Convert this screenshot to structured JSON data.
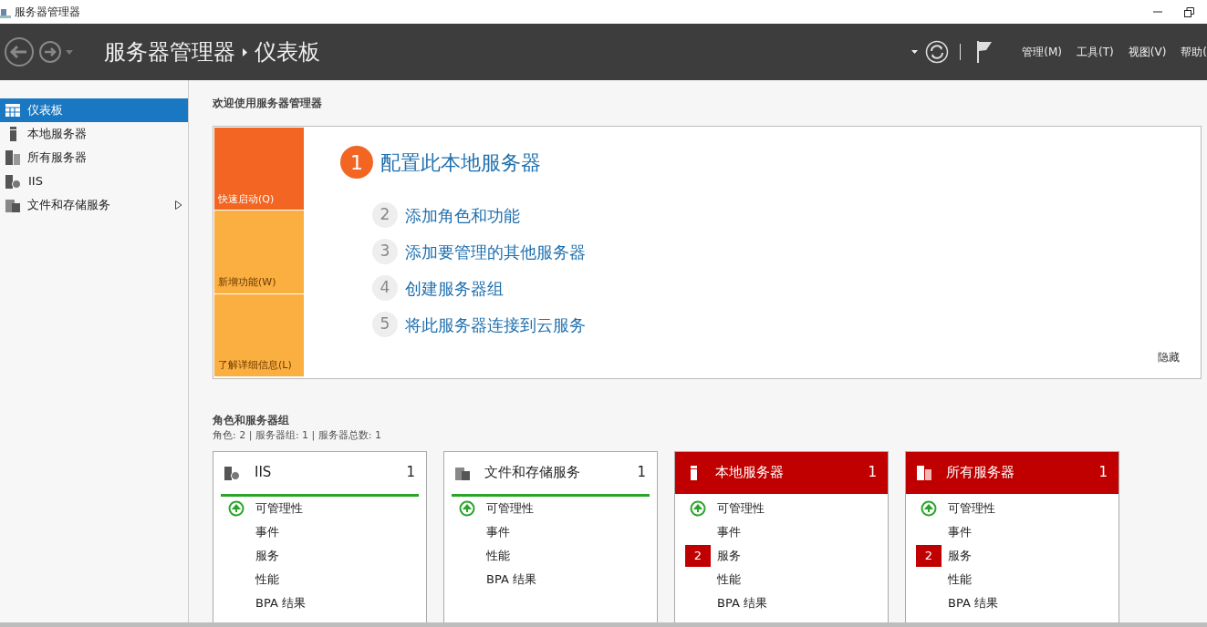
{
  "title_bar": {
    "title": "服务器管理器"
  },
  "header": {
    "breadcrumb": [
      "服务器管理器",
      "仪表板"
    ],
    "menus": [
      "管理(M)",
      "工具(T)",
      "视图(V)",
      "帮助("
    ]
  },
  "sidebar": {
    "items": [
      {
        "label": "仪表板",
        "selected": true,
        "expandable": false
      },
      {
        "label": "本地服务器",
        "selected": false,
        "expandable": false
      },
      {
        "label": "所有服务器",
        "selected": false,
        "expandable": false
      },
      {
        "label": "IIS",
        "selected": false,
        "expandable": false
      },
      {
        "label": "文件和存储服务",
        "selected": false,
        "expandable": true
      }
    ]
  },
  "welcome": {
    "title": "欢迎使用服务器管理器",
    "tiles": [
      {
        "label": "快速启动(Q)",
        "selected": true
      },
      {
        "label": "新增功能(W)",
        "selected": false
      },
      {
        "label": "了解详细信息(L)",
        "selected": false
      }
    ],
    "steps": [
      {
        "number": "1",
        "text": "配置此本地服务器",
        "selected": true
      },
      {
        "number": "2",
        "text": "添加角色和功能",
        "selected": false
      },
      {
        "number": "3",
        "text": "添加要管理的其他服务器",
        "selected": false
      },
      {
        "number": "4",
        "text": "创建服务器组",
        "selected": false
      },
      {
        "number": "5",
        "text": "将此服务器连接到云服务",
        "selected": false
      }
    ],
    "hide_link": "隐藏"
  },
  "roles": {
    "title": "角色和服务器组",
    "summary": "角色: 2 | 服务器组: 1 | 服务器总数: 1",
    "cards": [
      {
        "name": "IIS",
        "count": "1",
        "alert": false,
        "rows": [
          {
            "label": "可管理性",
            "kind": "ok"
          },
          {
            "label": "事件",
            "kind": "plain"
          },
          {
            "label": "服务",
            "kind": "plain"
          },
          {
            "label": "性能",
            "kind": "plain"
          },
          {
            "label": "BPA 结果",
            "kind": "plain"
          }
        ]
      },
      {
        "name": "文件和存储服务",
        "count": "1",
        "alert": false,
        "rows": [
          {
            "label": "可管理性",
            "kind": "ok"
          },
          {
            "label": "事件",
            "kind": "plain"
          },
          {
            "label": "性能",
            "kind": "plain"
          },
          {
            "label": "BPA 结果",
            "kind": "plain"
          }
        ]
      },
      {
        "name": "本地服务器",
        "count": "1",
        "alert": true,
        "rows": [
          {
            "label": "可管理性",
            "kind": "ok"
          },
          {
            "label": "事件",
            "kind": "plain"
          },
          {
            "label": "服务",
            "kind": "alert",
            "badge": "2"
          },
          {
            "label": "性能",
            "kind": "plain"
          },
          {
            "label": "BPA 结果",
            "kind": "plain"
          }
        ]
      },
      {
        "name": "所有服务器",
        "count": "1",
        "alert": true,
        "rows": [
          {
            "label": "可管理性",
            "kind": "ok"
          },
          {
            "label": "事件",
            "kind": "plain"
          },
          {
            "label": "服务",
            "kind": "alert",
            "badge": "2"
          },
          {
            "label": "性能",
            "kind": "plain"
          },
          {
            "label": "BPA 结果",
            "kind": "plain"
          }
        ]
      }
    ]
  }
}
